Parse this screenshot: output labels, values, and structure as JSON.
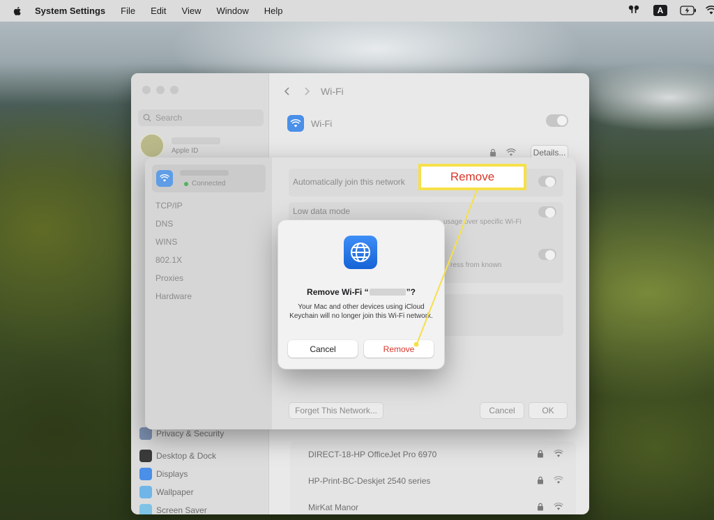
{
  "menubar": {
    "app_name": "System Settings",
    "menus": [
      "File",
      "Edit",
      "View",
      "Window",
      "Help"
    ],
    "input_source": "A"
  },
  "window": {
    "sidebar": {
      "search_placeholder": "Search",
      "apple_id_label": "Apple ID",
      "bottom_items": [
        {
          "label": "Privacy & Security",
          "icon": "hand-icon"
        },
        {
          "label": "Desktop & Dock",
          "icon": "dock-icon"
        },
        {
          "label": "Displays",
          "icon": "display-icon"
        },
        {
          "label": "Wallpaper",
          "icon": "wallpaper-icon"
        },
        {
          "label": "Screen Saver",
          "icon": "screensaver-icon"
        }
      ]
    },
    "content": {
      "title": "Wi-Fi",
      "wifi_label": "Wi-Fi",
      "details_button": "Details...",
      "networks": [
        {
          "name": "DIRECT-18-HP OfficeJet Pro 6970"
        },
        {
          "name": "HP-Print-BC-Deskjet 2540 series"
        },
        {
          "name": "MirKat Manor"
        }
      ]
    }
  },
  "sheet": {
    "network_status": "Connected",
    "tabs": [
      "TCP/IP",
      "DNS",
      "WINS",
      "802.1X",
      "Proxies",
      "Hardware"
    ],
    "auto_join_label": "Automatically join this network",
    "low_data_label": "Low data mode",
    "low_data_hint": "usage over specific Wi-Fi",
    "limit_hint": "ress from known",
    "forget_button": "Forget This Network...",
    "cancel_button": "Cancel",
    "ok_button": "OK"
  },
  "alert": {
    "title_prefix": "Remove Wi-Fi “",
    "title_suffix": "”?",
    "message": "Your Mac and other devices using iCloud Keychain will no longer join this Wi-Fi network.",
    "cancel_label": "Cancel",
    "remove_label": "Remove",
    "remove_color": "#d8362a"
  },
  "callout": {
    "label": "Remove",
    "border_color": "#f6e04a"
  }
}
